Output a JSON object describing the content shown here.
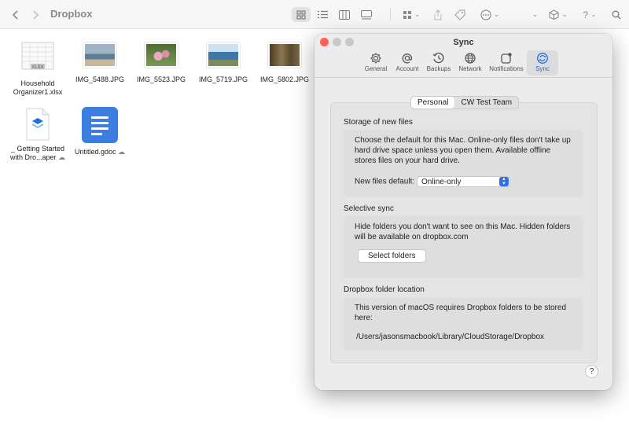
{
  "finder": {
    "title": "Dropbox",
    "files": [
      {
        "name": "Household Organizer1.xlsx",
        "type": "spreadsheet",
        "cloud": false
      },
      {
        "name": "IMG_5488.JPG",
        "type": "image",
        "color": "#a9b8c8",
        "cloud": false
      },
      {
        "name": "IMG_5523.JPG",
        "type": "image",
        "color": "#6d8a4a",
        "cloud": false
      },
      {
        "name": "IMG_5719.JPG",
        "type": "image",
        "color": "#4f7fa8",
        "cloud": false
      },
      {
        "name": "IMG_5802.JPG",
        "type": "image",
        "color": "#6b5a3c",
        "cloud": false
      },
      {
        "name": "_ Getting Started with Dro...aper",
        "type": "paper",
        "cloud": true
      },
      {
        "name": "Untitled.gdoc",
        "type": "gdoc",
        "cloud": true
      }
    ]
  },
  "sync_window": {
    "title": "Sync",
    "tabs": [
      {
        "label": "General",
        "icon": "gear-icon"
      },
      {
        "label": "Account",
        "icon": "at-icon"
      },
      {
        "label": "Backups",
        "icon": "clock-icon"
      },
      {
        "label": "Network",
        "icon": "globe-icon"
      },
      {
        "label": "Notifications",
        "icon": "notification-icon"
      },
      {
        "label": "Sync",
        "icon": "sync-icon",
        "active": true
      }
    ],
    "segments": [
      "Personal",
      "CW Test Team"
    ],
    "storage": {
      "title": "Storage of new files",
      "description": "Choose the default for this Mac. Online-only files don't take up hard drive space unless you open them. Available offline stores files on your hard drive.",
      "default_label": "New files default:",
      "default_value": "Online-only"
    },
    "selective": {
      "title": "Selective sync",
      "description": "Hide folders you don't want to see on this Mac. Hidden folders will be available on dropbox.com",
      "button": "Select folders"
    },
    "location": {
      "title": "Dropbox folder location",
      "description": "This version of macOS requires Dropbox folders to be stored here:",
      "path": "/Users/jasonsmacbook/Library/CloudStorage/Dropbox"
    },
    "help": "?"
  },
  "colors": {
    "accent": "#1a6ee8",
    "close": "#ff5f57",
    "minimize": "#c9c9c9",
    "zoom": "#c9c9c9"
  }
}
